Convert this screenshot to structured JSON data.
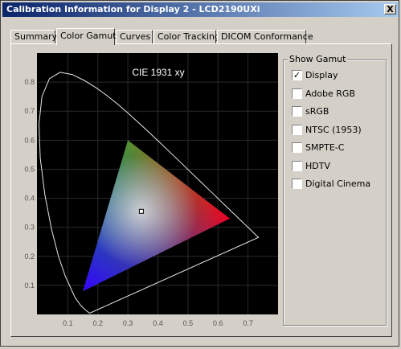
{
  "window": {
    "title": "Calibration Information for Display 2 - LCD2190UXi",
    "close_label": "X"
  },
  "tabs": [
    {
      "label": "Summary",
      "active": false
    },
    {
      "label": "Color Gamut",
      "active": true
    },
    {
      "label": "Curves",
      "active": false
    },
    {
      "label": "Color Tracking",
      "active": false
    },
    {
      "label": "DICOM Conformance",
      "active": false
    }
  ],
  "chart_data": {
    "type": "scatter",
    "title": "CIE 1931 xy",
    "xlabel": "",
    "ylabel": "",
    "xlim": [
      0.0,
      0.8
    ],
    "ylim": [
      0.0,
      0.9
    ],
    "x_ticks": [
      "0.1",
      "0.2",
      "0.3",
      "0.4",
      "0.5",
      "0.6",
      "0.7"
    ],
    "y_ticks": [
      "0.1",
      "0.2",
      "0.3",
      "0.4",
      "0.5",
      "0.6",
      "0.7",
      "0.8"
    ],
    "grid": true,
    "gamut_triangle": {
      "red": [
        0.64,
        0.33
      ],
      "green": [
        0.3,
        0.6
      ],
      "blue": [
        0.15,
        0.08
      ],
      "white_point": [
        0.345,
        0.355
      ]
    }
  },
  "show_gamut": {
    "title": "Show Gamut",
    "options": [
      {
        "label": "Display",
        "checked": true
      },
      {
        "label": "Adobe RGB",
        "checked": false
      },
      {
        "label": "sRGB",
        "checked": false
      },
      {
        "label": "NTSC (1953)",
        "checked": false
      },
      {
        "label": "SMPTE-C",
        "checked": false
      },
      {
        "label": "HDTV",
        "checked": false
      },
      {
        "label": "Digital Cinema",
        "checked": false
      }
    ]
  }
}
